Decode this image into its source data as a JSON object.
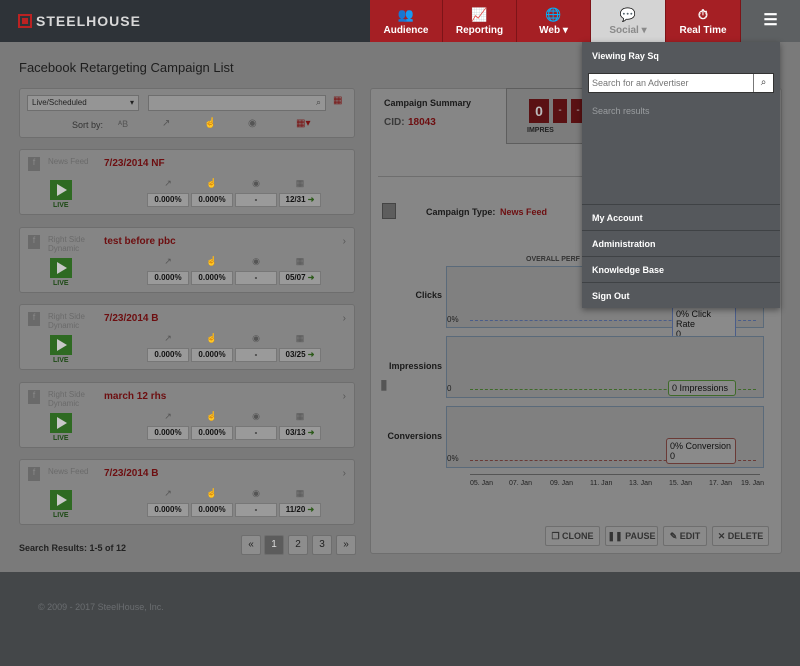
{
  "logo": {
    "text": "STEELHOUSE"
  },
  "nav": {
    "audience": "Audience",
    "reporting": "Reporting",
    "web": "Web",
    "social": "Social",
    "realtime": "Real Time"
  },
  "page_title": "Facebook Retargeting Campaign List",
  "filter": {
    "select": "Live/Scheduled",
    "sort_by": "Sort by:"
  },
  "campaigns": [
    {
      "source": "News Feed",
      "name": "7/23/2014 NF",
      "ctr": "0.000%",
      "cvr": "0.000%",
      "views": "-",
      "date": "12/31"
    },
    {
      "source": "Right Side Dynamic",
      "name": "test before pbc",
      "ctr": "0.000%",
      "cvr": "0.000%",
      "views": "-",
      "date": "05/07"
    },
    {
      "source": "Right Side Dynamic",
      "name": "7/23/2014 B",
      "ctr": "0.000%",
      "cvr": "0.000%",
      "views": "-",
      "date": "03/25"
    },
    {
      "source": "Right Side Dynamic",
      "name": "march 12 rhs",
      "ctr": "0.000%",
      "cvr": "0.000%",
      "views": "-",
      "date": "03/13"
    },
    {
      "source": "News Feed",
      "name": "7/23/2014 B",
      "ctr": "0.000%",
      "cvr": "0.000%",
      "views": "-",
      "date": "11/20"
    }
  ],
  "live_label": "LIVE",
  "search_results": "Search Results: 1-5 of 12",
  "pager": {
    "prev": "«",
    "p1": "1",
    "p2": "2",
    "p3": "3",
    "next": "»"
  },
  "summary": {
    "title": "Campaign Summary",
    "cid_label": "CID:",
    "cid": "18043",
    "counter": "0",
    "impressions": "IMPRES",
    "type_label": "Campaign Type:",
    "type": "News Feed",
    "overall": "OVERALL PERF"
  },
  "charts": {
    "clicks": {
      "label": "Clicks",
      "zero": "0%",
      "tip1": "0% Click Rate",
      "tip2": "0"
    },
    "impressions": {
      "label": "Impressions",
      "zero": "0",
      "tip1": "0 Impressions"
    },
    "conversions": {
      "label": "Conversions",
      "zero": "0%",
      "tip1": "0% Conversion",
      "tip2": "0"
    },
    "xticks": [
      "05. Jan",
      "07. Jan",
      "09. Jan",
      "11. Jan",
      "13. Jan",
      "15. Jan",
      "17. Jan",
      "19. Jan"
    ]
  },
  "actions": {
    "clone": "CLONE",
    "pause": "PAUSE",
    "edit": "EDIT",
    "delete": "DELETE"
  },
  "footer": "© 2009 - 2017 SteelHouse, Inc.",
  "dropdown": {
    "viewing": "Viewing Ray Sq",
    "search_placeholder": "Search for an Advertiser",
    "results": "Search results",
    "items": [
      "My Account",
      "Administration",
      "Knowledge Base",
      "Sign Out"
    ]
  },
  "colors": {
    "brand_red": "#c8102e",
    "nav_dark": "#2e3338"
  }
}
